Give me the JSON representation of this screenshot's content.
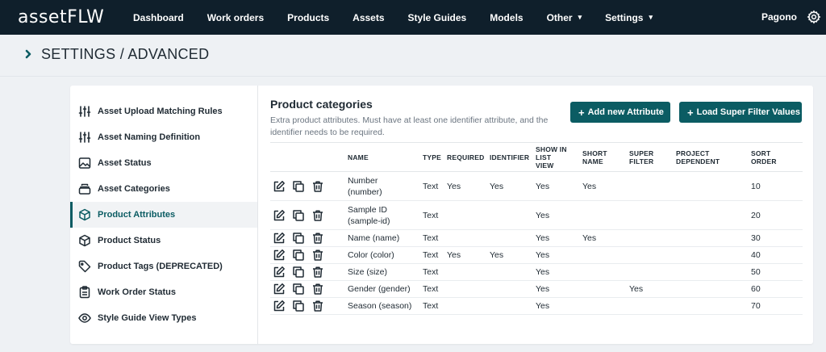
{
  "app": {
    "logo_text": "assetFLW"
  },
  "nav": {
    "items": [
      {
        "label": "Dashboard"
      },
      {
        "label": "Work orders"
      },
      {
        "label": "Products"
      },
      {
        "label": "Assets"
      },
      {
        "label": "Style Guides"
      },
      {
        "label": "Models"
      },
      {
        "label": "Other",
        "dropdown": true
      },
      {
        "label": "Settings",
        "dropdown": true
      }
    ],
    "user": "Pagono",
    "settings_icon": "gear-icon"
  },
  "page": {
    "title": "SETTINGS / ADVANCED"
  },
  "sidebar": {
    "items": [
      {
        "label": "Asset Upload Matching Rules",
        "icon": "sliders-icon"
      },
      {
        "label": "Asset Naming Definition",
        "icon": "sliders-icon"
      },
      {
        "label": "Asset Status",
        "icon": "image-icon"
      },
      {
        "label": "Asset Categories",
        "icon": "stack-icon"
      },
      {
        "label": "Product Attributes",
        "icon": "cube-icon",
        "active": true
      },
      {
        "label": "Product Status",
        "icon": "cube-icon"
      },
      {
        "label": "Product Tags (DEPRECATED)",
        "icon": "tag-icon"
      },
      {
        "label": "Work Order Status",
        "icon": "clipboard-icon"
      },
      {
        "label": "Style Guide View Types",
        "icon": "eye-icon"
      }
    ]
  },
  "section": {
    "title": "Product categories",
    "description": "Extra product attributes. Must have at least one identifier attribute, and the identifier needs to be required.",
    "add_button": "Add new Attribute",
    "load_button": "Load Super Filter Values"
  },
  "table": {
    "headers": {
      "name": "NAME",
      "type": "TYPE",
      "required": "REQUIRED",
      "identifier": "IDENTIFIER",
      "show_list_1": "SHOW IN LIST",
      "show_list_2": "VIEW",
      "short_1": "SHORT",
      "short_2": "NAME",
      "super_1": "SUPER",
      "super_2": "FILTER",
      "project_1": "PROJECT",
      "project_2": "DEPENDENT",
      "sort_1": "SORT",
      "sort_2": "ORDER"
    },
    "rows": [
      {
        "name_1": "Number",
        "name_2": "(number)",
        "type": "Text",
        "required": "Yes",
        "identifier": "Yes",
        "show_in_list": "Yes",
        "short_name": "Yes",
        "super_filter": "",
        "project_dependent": "",
        "sort_order": "10"
      },
      {
        "name_1": "Sample ID",
        "name_2": "(sample-id)",
        "type": "Text",
        "required": "",
        "identifier": "",
        "show_in_list": "Yes",
        "short_name": "",
        "super_filter": "",
        "project_dependent": "",
        "sort_order": "20"
      },
      {
        "name_1": "Name (name)",
        "name_2": "",
        "type": "Text",
        "required": "",
        "identifier": "",
        "show_in_list": "Yes",
        "short_name": "Yes",
        "super_filter": "",
        "project_dependent": "",
        "sort_order": "30"
      },
      {
        "name_1": "Color (color)",
        "name_2": "",
        "type": "Text",
        "required": "Yes",
        "identifier": "Yes",
        "show_in_list": "Yes",
        "short_name": "",
        "super_filter": "",
        "project_dependent": "",
        "sort_order": "40"
      },
      {
        "name_1": "Size (size)",
        "name_2": "",
        "type": "Text",
        "required": "",
        "identifier": "",
        "show_in_list": "Yes",
        "short_name": "",
        "super_filter": "",
        "project_dependent": "",
        "sort_order": "50"
      },
      {
        "name_1": "Gender (gender)",
        "name_2": "",
        "type": "Text",
        "required": "",
        "identifier": "",
        "show_in_list": "Yes",
        "short_name": "",
        "super_filter": "Yes",
        "project_dependent": "",
        "sort_order": "60"
      },
      {
        "name_1": "Season (season)",
        "name_2": "",
        "type": "Text",
        "required": "",
        "identifier": "",
        "show_in_list": "Yes",
        "short_name": "",
        "super_filter": "",
        "project_dependent": "",
        "sort_order": "70"
      }
    ]
  },
  "colors": {
    "topbar": "#0f1f2b",
    "accent": "#0b5c63",
    "background": "#eef1f4"
  }
}
